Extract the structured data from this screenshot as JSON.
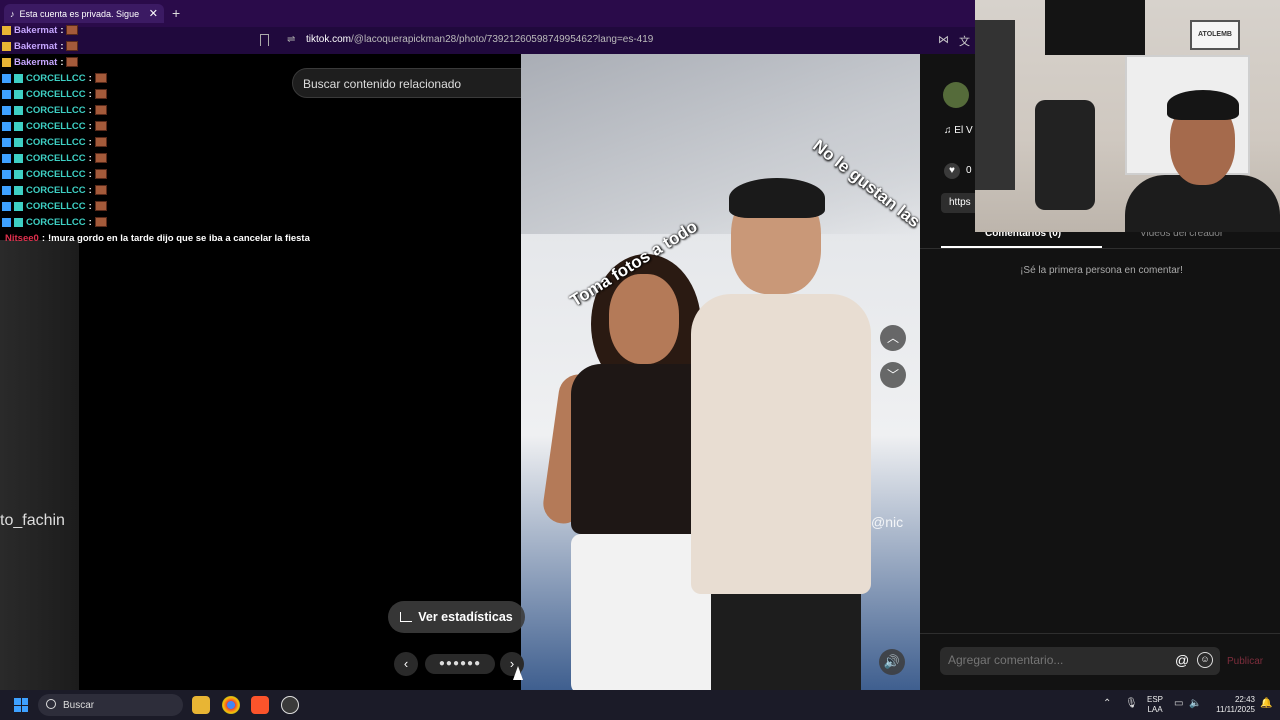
{
  "browser": {
    "tab_title": "Esta cuenta es privada. Sigue",
    "tab_close": "✕",
    "new_tab": "+",
    "url_domain": "tiktok.com",
    "url_path": "/@lacoquerapickman28/photo/7392126059874995462?lang=es-419"
  },
  "chat": {
    "lines": [
      {
        "user": "Bakermat",
        "sep": ":",
        "msg": ""
      },
      {
        "user": "Bakermat",
        "sep": ":",
        "msg": ""
      },
      {
        "user": "Bakermat",
        "sep": ":",
        "msg": ""
      },
      {
        "user": "CORCELLCC",
        "sep": ":",
        "msg": ""
      },
      {
        "user": "CORCELLCC",
        "sep": ":",
        "msg": ""
      },
      {
        "user": "CORCELLCC",
        "sep": ":",
        "msg": ""
      },
      {
        "user": "CORCELLCC",
        "sep": ":",
        "msg": ""
      },
      {
        "user": "CORCELLCC",
        "sep": ":",
        "msg": ""
      },
      {
        "user": "CORCELLCC",
        "sep": ":",
        "msg": ""
      },
      {
        "user": "CORCELLCC",
        "sep": ":",
        "msg": ""
      },
      {
        "user": "CORCELLCC",
        "sep": ":",
        "msg": ""
      },
      {
        "user": "CORCELLCC",
        "sep": ":",
        "msg": ""
      },
      {
        "user": "CORCELLCC",
        "sep": ":",
        "msg": ""
      },
      {
        "user": "Nitsee0",
        "sep": ":",
        "msg": "!mura gordo en la tarde dijo que se iba a cancelar la fiesta"
      }
    ]
  },
  "left_overlay": {
    "name": "to_fachin"
  },
  "viewer": {
    "search_placeholder": "Buscar contenido relacionado",
    "more": "•••",
    "overlay_text_1": "Toma fotos a todo",
    "overlay_text_2": "No le gustan las",
    "watermark": "@nic",
    "nav_up": "︿",
    "nav_down": "﹀",
    "stats_label": "Ver estadísticas",
    "prev": "‹",
    "next": "›",
    "dots": "●●●●●●",
    "volume": "🔊"
  },
  "right_panel": {
    "music": "♫ El V",
    "like_icon": "♥",
    "likes": "0",
    "link": "https",
    "tab_comments": "Comentarios (0)",
    "tab_creator": "Videos del creador",
    "empty_msg": "¡Sé la primera persona en comentar!",
    "comment_placeholder": "Agregar comentario...",
    "at": "@",
    "emoji": "☺",
    "post": "Publicar"
  },
  "webcam": {
    "logo_text": "ATOLEMB"
  },
  "taskbar": {
    "search_label": "Buscar",
    "lang_1": "ESP",
    "lang_2": "LAA",
    "time": "22:43",
    "date": "11/11/2025",
    "tray_chevron": "⌃",
    "mic": "🎙",
    "vol": "🔈"
  },
  "colors": {
    "tabbar": "#2a0b4a",
    "chat_baker": "#c6a6ff",
    "chat_corcel": "#3ed0c4",
    "chat_nitsee": "#e0304d"
  }
}
